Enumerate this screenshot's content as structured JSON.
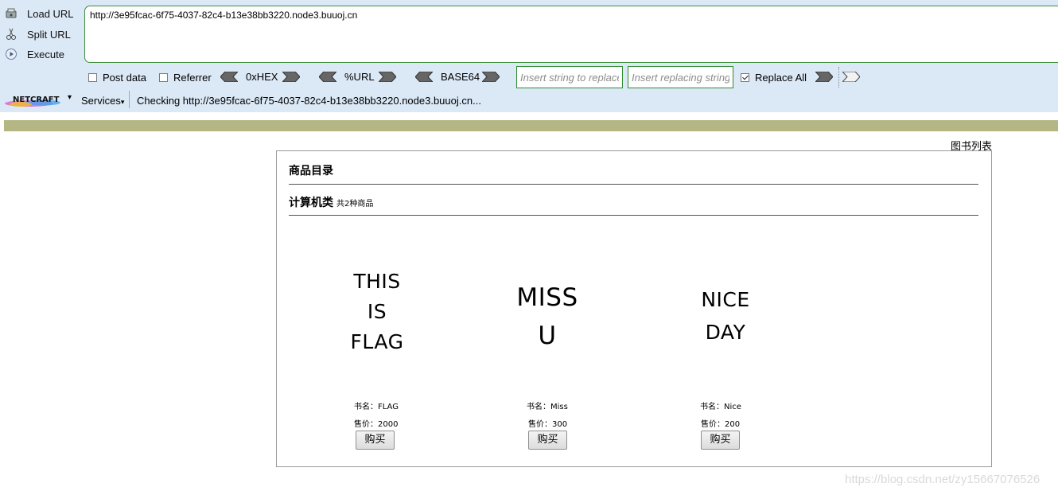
{
  "hackbar": {
    "load_url": "Load URL",
    "split_url": "Split URL",
    "execute": "Execute",
    "url_value": "http://3e95fcac-6f75-4037-82c4-b13e38bb3220.node3.buuoj.cn",
    "post_data": "Post data",
    "referrer": "Referrer",
    "hex": "0xHEX",
    "url_enc": "%URL",
    "base64": "BASE64",
    "replace_from_placeholder": "Insert string to replace",
    "replace_to_placeholder": "Insert replacing string",
    "replace_all": "Replace All",
    "replace_all_checked": true
  },
  "netcraft": {
    "logo": "NETCRAFT",
    "services": "Services",
    "status": "Checking http://3e95fcac-6f75-4037-82c4-b13e38bb3220.node3.buuoj.cn..."
  },
  "page": {
    "booklist_link": "图书列表",
    "catalog_title": "商品目录",
    "category_title": "计算机类",
    "category_count": "共2种商品",
    "products": [
      {
        "cover_lines": [
          "THIS",
          "IS",
          "FLAG"
        ],
        "name": "书名：FLAG",
        "price": "售价：2000",
        "buy": "购买"
      },
      {
        "cover_lines": [
          "MISS",
          "U"
        ],
        "name": "书名：Miss",
        "price": "售价：300",
        "buy": "购买"
      },
      {
        "cover_lines": [
          "NICE",
          "DAY"
        ],
        "name": "书名：Nice",
        "price": "售价：200",
        "buy": "购买"
      }
    ]
  },
  "watermark": "https://blog.csdn.net/zy15667076526",
  "colors": {
    "toolbar_bg": "#dbe8f6",
    "olive_bar": "#b4b783",
    "input_border": "#2e8b2e"
  }
}
